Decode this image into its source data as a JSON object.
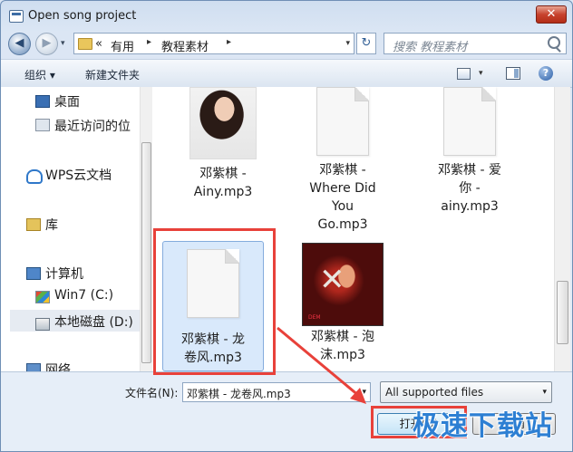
{
  "window": {
    "title": "Open song project",
    "close_label": "✕"
  },
  "nav": {
    "back_label": "◀",
    "forward_label": "▶",
    "nav_dropdown": "▾",
    "breadcrumb_lead": "«",
    "breadcrumbs": [
      "有用",
      "教程素材"
    ],
    "crumb_sep": "▸",
    "address_dropdown": "▾",
    "refresh_label": "↻",
    "search_placeholder": "搜索 教程素材"
  },
  "toolbar": {
    "organize": "组织 ▾",
    "new_folder": "新建文件夹",
    "view_dropdown": "▾",
    "help_label": "?"
  },
  "sidebar": {
    "items": [
      {
        "label": "桌面",
        "icon": "desktop-icon"
      },
      {
        "label": "最近访问的位",
        "icon": "recent-places-icon"
      },
      {
        "label": "WPS云文档",
        "icon": "cloud-icon"
      },
      {
        "label": "库",
        "icon": "library-icon"
      },
      {
        "label": "计算机",
        "icon": "computer-icon"
      },
      {
        "label": "Win7 (C:)",
        "icon": "windows-drive-icon"
      },
      {
        "label": "本地磁盘 (D:)",
        "icon": "local-disk-icon",
        "selected": true
      },
      {
        "label": "网络",
        "icon": "network-icon"
      }
    ]
  },
  "files": [
    {
      "name_lines": [
        "邓紫棋 -",
        "Ainy.mp3"
      ],
      "thumb": "photo"
    },
    {
      "name_lines": [
        "邓紫棋 -",
        "Where Did",
        "You",
        "Go.mp3"
      ],
      "thumb": "document"
    },
    {
      "name_lines": [
        "邓紫棋 - 爱",
        "你 -",
        "ainy.mp3"
      ],
      "thumb": "document"
    },
    {
      "name_lines": [
        "邓紫棋 - 龙",
        "卷风.mp3"
      ],
      "thumb": "document",
      "selected": true
    },
    {
      "name_lines": [
        "邓紫棋 - 泡",
        "沫.mp3"
      ],
      "thumb": "album-art",
      "art_caption": "DEM"
    }
  ],
  "bottom": {
    "filename_label": "文件名(N):",
    "filename_value": "邓紫棋 - 龙卷风.mp3",
    "filename_dropdown": "▾",
    "filter_value": "All supported files",
    "filter_dropdown": "▾",
    "open_label": "打开(O)",
    "cancel_label": "取消"
  },
  "overlay": {
    "watermark": "极速下载站",
    "highlight_color": "#e8413a"
  }
}
